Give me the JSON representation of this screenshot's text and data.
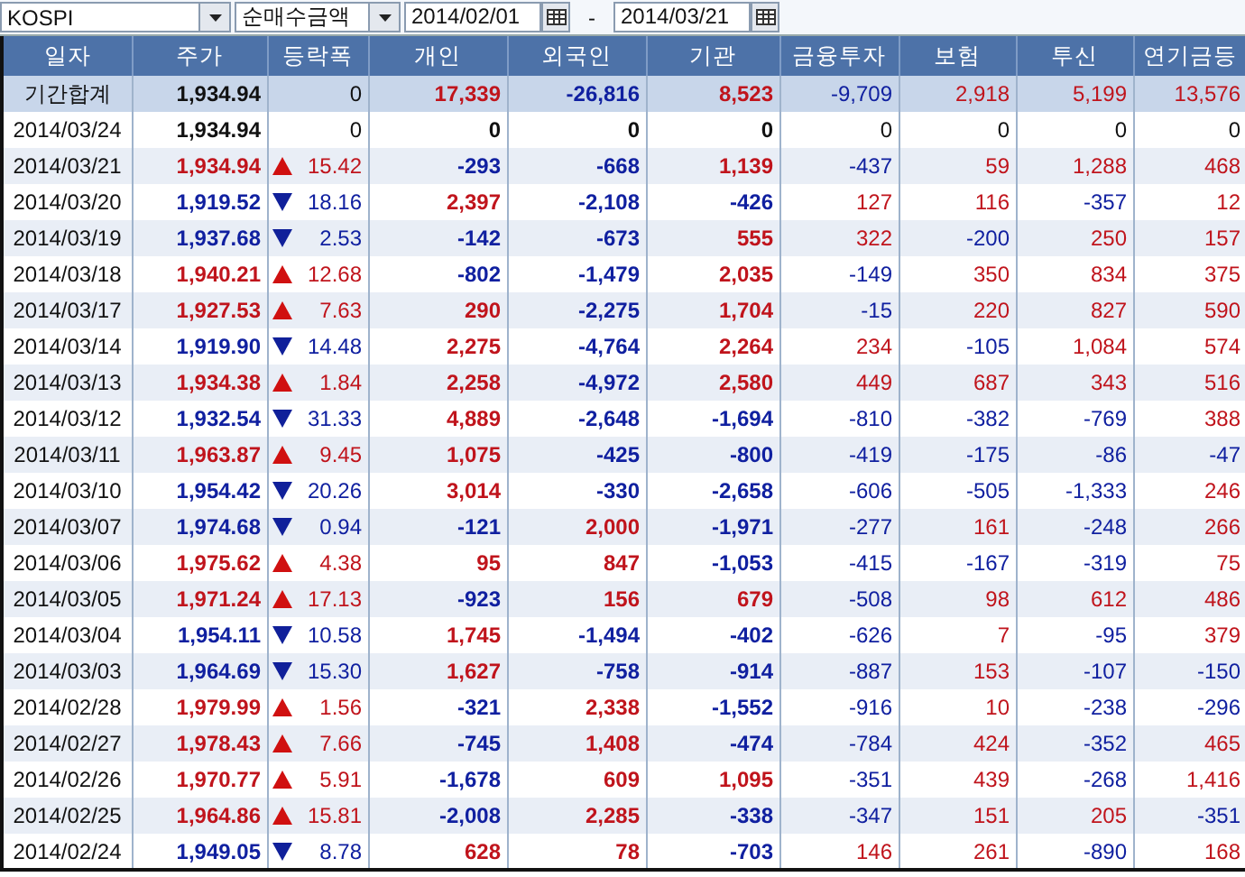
{
  "toolbar": {
    "market": "KOSPI",
    "mode": "순매수금액",
    "start_date": "2014/02/01",
    "separator": "-",
    "end_date": "2014/03/21"
  },
  "table": {
    "columns": [
      "일자",
      "주가",
      "등락폭",
      "개인",
      "외국인",
      "기관",
      "금융투자",
      "보험",
      "투신",
      "연기금등"
    ],
    "rows": [
      {
        "kind": "total",
        "cells": [
          "기간합계",
          "1,934.94",
          "0",
          "17,339",
          "-26,816",
          "8,523",
          "-9,709",
          "2,918",
          "5,199",
          "13,576"
        ]
      },
      {
        "kind": "flat",
        "cells": [
          "2014/03/24",
          "1,934.94",
          "0",
          "0",
          "0",
          "0",
          "0",
          "0",
          "0",
          "0"
        ]
      },
      {
        "kind": "up",
        "cells": [
          "2014/03/21",
          "1,934.94",
          "15.42",
          "-293",
          "-668",
          "1,139",
          "-437",
          "59",
          "1,288",
          "468"
        ]
      },
      {
        "kind": "down",
        "cells": [
          "2014/03/20",
          "1,919.52",
          "18.16",
          "2,397",
          "-2,108",
          "-426",
          "127",
          "116",
          "-357",
          "12"
        ]
      },
      {
        "kind": "down",
        "cells": [
          "2014/03/19",
          "1,937.68",
          "2.53",
          "-142",
          "-673",
          "555",
          "322",
          "-200",
          "250",
          "157"
        ]
      },
      {
        "kind": "up",
        "cells": [
          "2014/03/18",
          "1,940.21",
          "12.68",
          "-802",
          "-1,479",
          "2,035",
          "-149",
          "350",
          "834",
          "375"
        ]
      },
      {
        "kind": "up",
        "cells": [
          "2014/03/17",
          "1,927.53",
          "7.63",
          "290",
          "-2,275",
          "1,704",
          "-15",
          "220",
          "827",
          "590"
        ]
      },
      {
        "kind": "down",
        "cells": [
          "2014/03/14",
          "1,919.90",
          "14.48",
          "2,275",
          "-4,764",
          "2,264",
          "234",
          "-105",
          "1,084",
          "574"
        ]
      },
      {
        "kind": "up",
        "cells": [
          "2014/03/13",
          "1,934.38",
          "1.84",
          "2,258",
          "-4,972",
          "2,580",
          "449",
          "687",
          "343",
          "516"
        ]
      },
      {
        "kind": "down",
        "cells": [
          "2014/03/12",
          "1,932.54",
          "31.33",
          "4,889",
          "-2,648",
          "-1,694",
          "-810",
          "-382",
          "-769",
          "388"
        ]
      },
      {
        "kind": "up",
        "cells": [
          "2014/03/11",
          "1,963.87",
          "9.45",
          "1,075",
          "-425",
          "-800",
          "-419",
          "-175",
          "-86",
          "-47"
        ]
      },
      {
        "kind": "down",
        "cells": [
          "2014/03/10",
          "1,954.42",
          "20.26",
          "3,014",
          "-330",
          "-2,658",
          "-606",
          "-505",
          "-1,333",
          "246"
        ]
      },
      {
        "kind": "down",
        "cells": [
          "2014/03/07",
          "1,974.68",
          "0.94",
          "-121",
          "2,000",
          "-1,971",
          "-277",
          "161",
          "-248",
          "266"
        ]
      },
      {
        "kind": "up",
        "cells": [
          "2014/03/06",
          "1,975.62",
          "4.38",
          "95",
          "847",
          "-1,053",
          "-415",
          "-167",
          "-319",
          "75"
        ]
      },
      {
        "kind": "up",
        "cells": [
          "2014/03/05",
          "1,971.24",
          "17.13",
          "-923",
          "156",
          "679",
          "-508",
          "98",
          "612",
          "486"
        ]
      },
      {
        "kind": "down",
        "cells": [
          "2014/03/04",
          "1,954.11",
          "10.58",
          "1,745",
          "-1,494",
          "-402",
          "-626",
          "7",
          "-95",
          "379"
        ]
      },
      {
        "kind": "down",
        "cells": [
          "2014/03/03",
          "1,964.69",
          "15.30",
          "1,627",
          "-758",
          "-914",
          "-887",
          "153",
          "-107",
          "-150"
        ]
      },
      {
        "kind": "up",
        "cells": [
          "2014/02/28",
          "1,979.99",
          "1.56",
          "-321",
          "2,338",
          "-1,552",
          "-916",
          "10",
          "-238",
          "-296"
        ]
      },
      {
        "kind": "up",
        "cells": [
          "2014/02/27",
          "1,978.43",
          "7.66",
          "-745",
          "1,408",
          "-474",
          "-784",
          "424",
          "-352",
          "465"
        ]
      },
      {
        "kind": "up",
        "cells": [
          "2014/02/26",
          "1,970.77",
          "5.91",
          "-1,678",
          "609",
          "1,095",
          "-351",
          "439",
          "-268",
          "1,416"
        ]
      },
      {
        "kind": "up",
        "cells": [
          "2014/02/25",
          "1,964.86",
          "15.81",
          "-2,008",
          "2,285",
          "-338",
          "-347",
          "151",
          "205",
          "-351"
        ]
      },
      {
        "kind": "down",
        "cells": [
          "2014/02/24",
          "1,949.05",
          "8.78",
          "628",
          "78",
          "-703",
          "146",
          "261",
          "-890",
          "168"
        ]
      }
    ]
  }
}
